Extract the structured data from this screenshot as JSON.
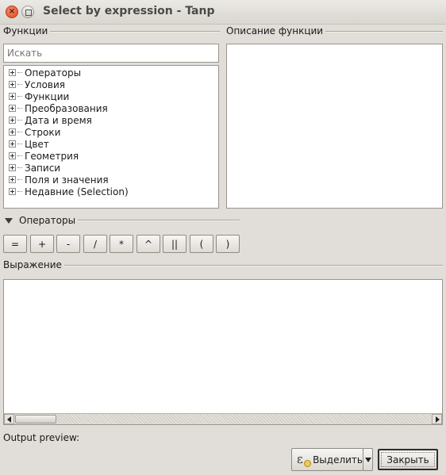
{
  "window": {
    "title": "Select by expression - Tanp",
    "close_glyph": "×"
  },
  "functions_panel": {
    "header": "Функции",
    "search_placeholder": "Искать",
    "tree_items": [
      "Операторы",
      "Условия",
      "Функции",
      "Преобразования",
      "Дата и время",
      "Строки",
      "Цвет",
      "Геометрия",
      "Записи",
      "Поля и значения",
      "Недавние (Selection)"
    ]
  },
  "description_panel": {
    "header": "Описание функции"
  },
  "operators": {
    "header": "Операторы",
    "buttons": [
      "=",
      "+",
      "-",
      "/",
      "*",
      "^",
      "||",
      "(",
      ")"
    ]
  },
  "expression": {
    "header": "Выражение",
    "value": ""
  },
  "output_preview": {
    "label": "Output preview:"
  },
  "actions": {
    "select_label": "Выделить",
    "close_label": "Закрыть",
    "select_icon": "ε"
  },
  "colors": {
    "window_bg": "#e1ddd8",
    "close_button": "#dd4a1e"
  }
}
